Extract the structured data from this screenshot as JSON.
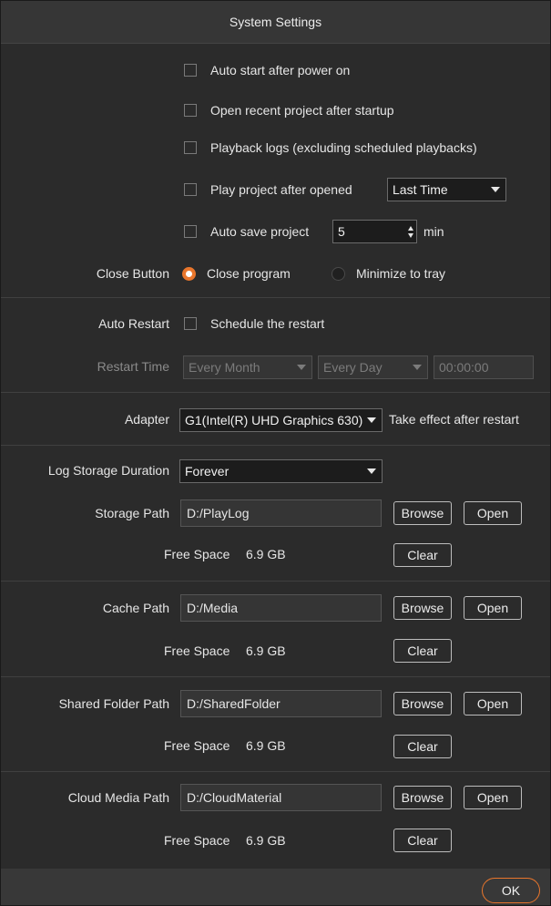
{
  "window": {
    "title": "System Settings"
  },
  "general": {
    "auto_start": "Auto start after power on",
    "open_recent": "Open recent project after startup",
    "playback_logs": "Playback logs (excluding scheduled playbacks)",
    "play_after_opened": "Play project after opened",
    "play_after_opened_value": "Last Time",
    "auto_save": "Auto save project",
    "auto_save_value": "5",
    "auto_save_unit": "min"
  },
  "close_button": {
    "label": "Close Button",
    "option_close": "Close program",
    "option_minimize": "Minimize to tray",
    "selected": "Close program"
  },
  "auto_restart": {
    "label": "Auto Restart",
    "schedule": "Schedule the restart",
    "time_label": "Restart Time",
    "frequency": "Every Month",
    "day": "Every Day",
    "time": "00:00:00"
  },
  "adapter": {
    "label": "Adapter",
    "value": "G1(Intel(R) UHD Graphics 630)",
    "note": "Take effect after restart"
  },
  "logs": {
    "duration_label": "Log Storage Duration",
    "duration_value": "Forever"
  },
  "paths": [
    {
      "label": "Storage Path",
      "value": "D:/PlayLog",
      "free_label": "Free Space",
      "free_value": "6.9 GB"
    },
    {
      "label": "Cache Path",
      "value": "D:/Media",
      "free_label": "Free Space",
      "free_value": "6.9 GB"
    },
    {
      "label": "Shared Folder Path",
      "value": "D:/SharedFolder",
      "free_label": "Free Space",
      "free_value": "6.9 GB"
    },
    {
      "label": "Cloud Media Path",
      "value": "D:/CloudMaterial",
      "free_label": "Free Space",
      "free_value": "6.9 GB"
    }
  ],
  "buttons": {
    "browse": "Browse",
    "open": "Open",
    "clear": "Clear",
    "ok": "OK"
  },
  "colors": {
    "accent": "#e9762c",
    "background": "#2b2b2b",
    "titlebar": "#363636"
  }
}
